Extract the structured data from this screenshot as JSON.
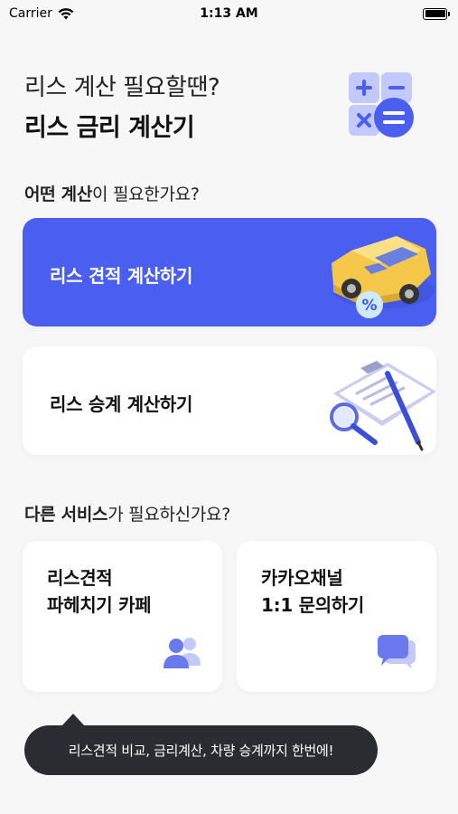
{
  "status_bar": {
    "carrier": "Carrier",
    "time": "1:13 AM"
  },
  "header": {
    "subtitle": "리스 계산 필요할땐?",
    "title": "리스 금리 계산기"
  },
  "calc_section": {
    "title_bold": "어떤 계산",
    "title_rest": "이 필요한가요?",
    "options": [
      {
        "label": "리스 견적 계산하기",
        "icon": "car-percent-icon",
        "accent": "#4a5ef0"
      },
      {
        "label": "리스 승계 계산하기",
        "icon": "contract-icon"
      }
    ]
  },
  "services_section": {
    "title_bold": "다른 서비스",
    "title_rest": "가 필요하신가요?",
    "cards": [
      {
        "line1": "리스견적",
        "line2": "파헤치기 카페",
        "icon": "people-icon"
      },
      {
        "line1": "카카오채널",
        "line2": "1:1 문의하기",
        "icon": "chat-icon"
      }
    ]
  },
  "tooltip": {
    "text": "리스견적 비교, 금리계산, 차량 승계까지 한번에!"
  }
}
